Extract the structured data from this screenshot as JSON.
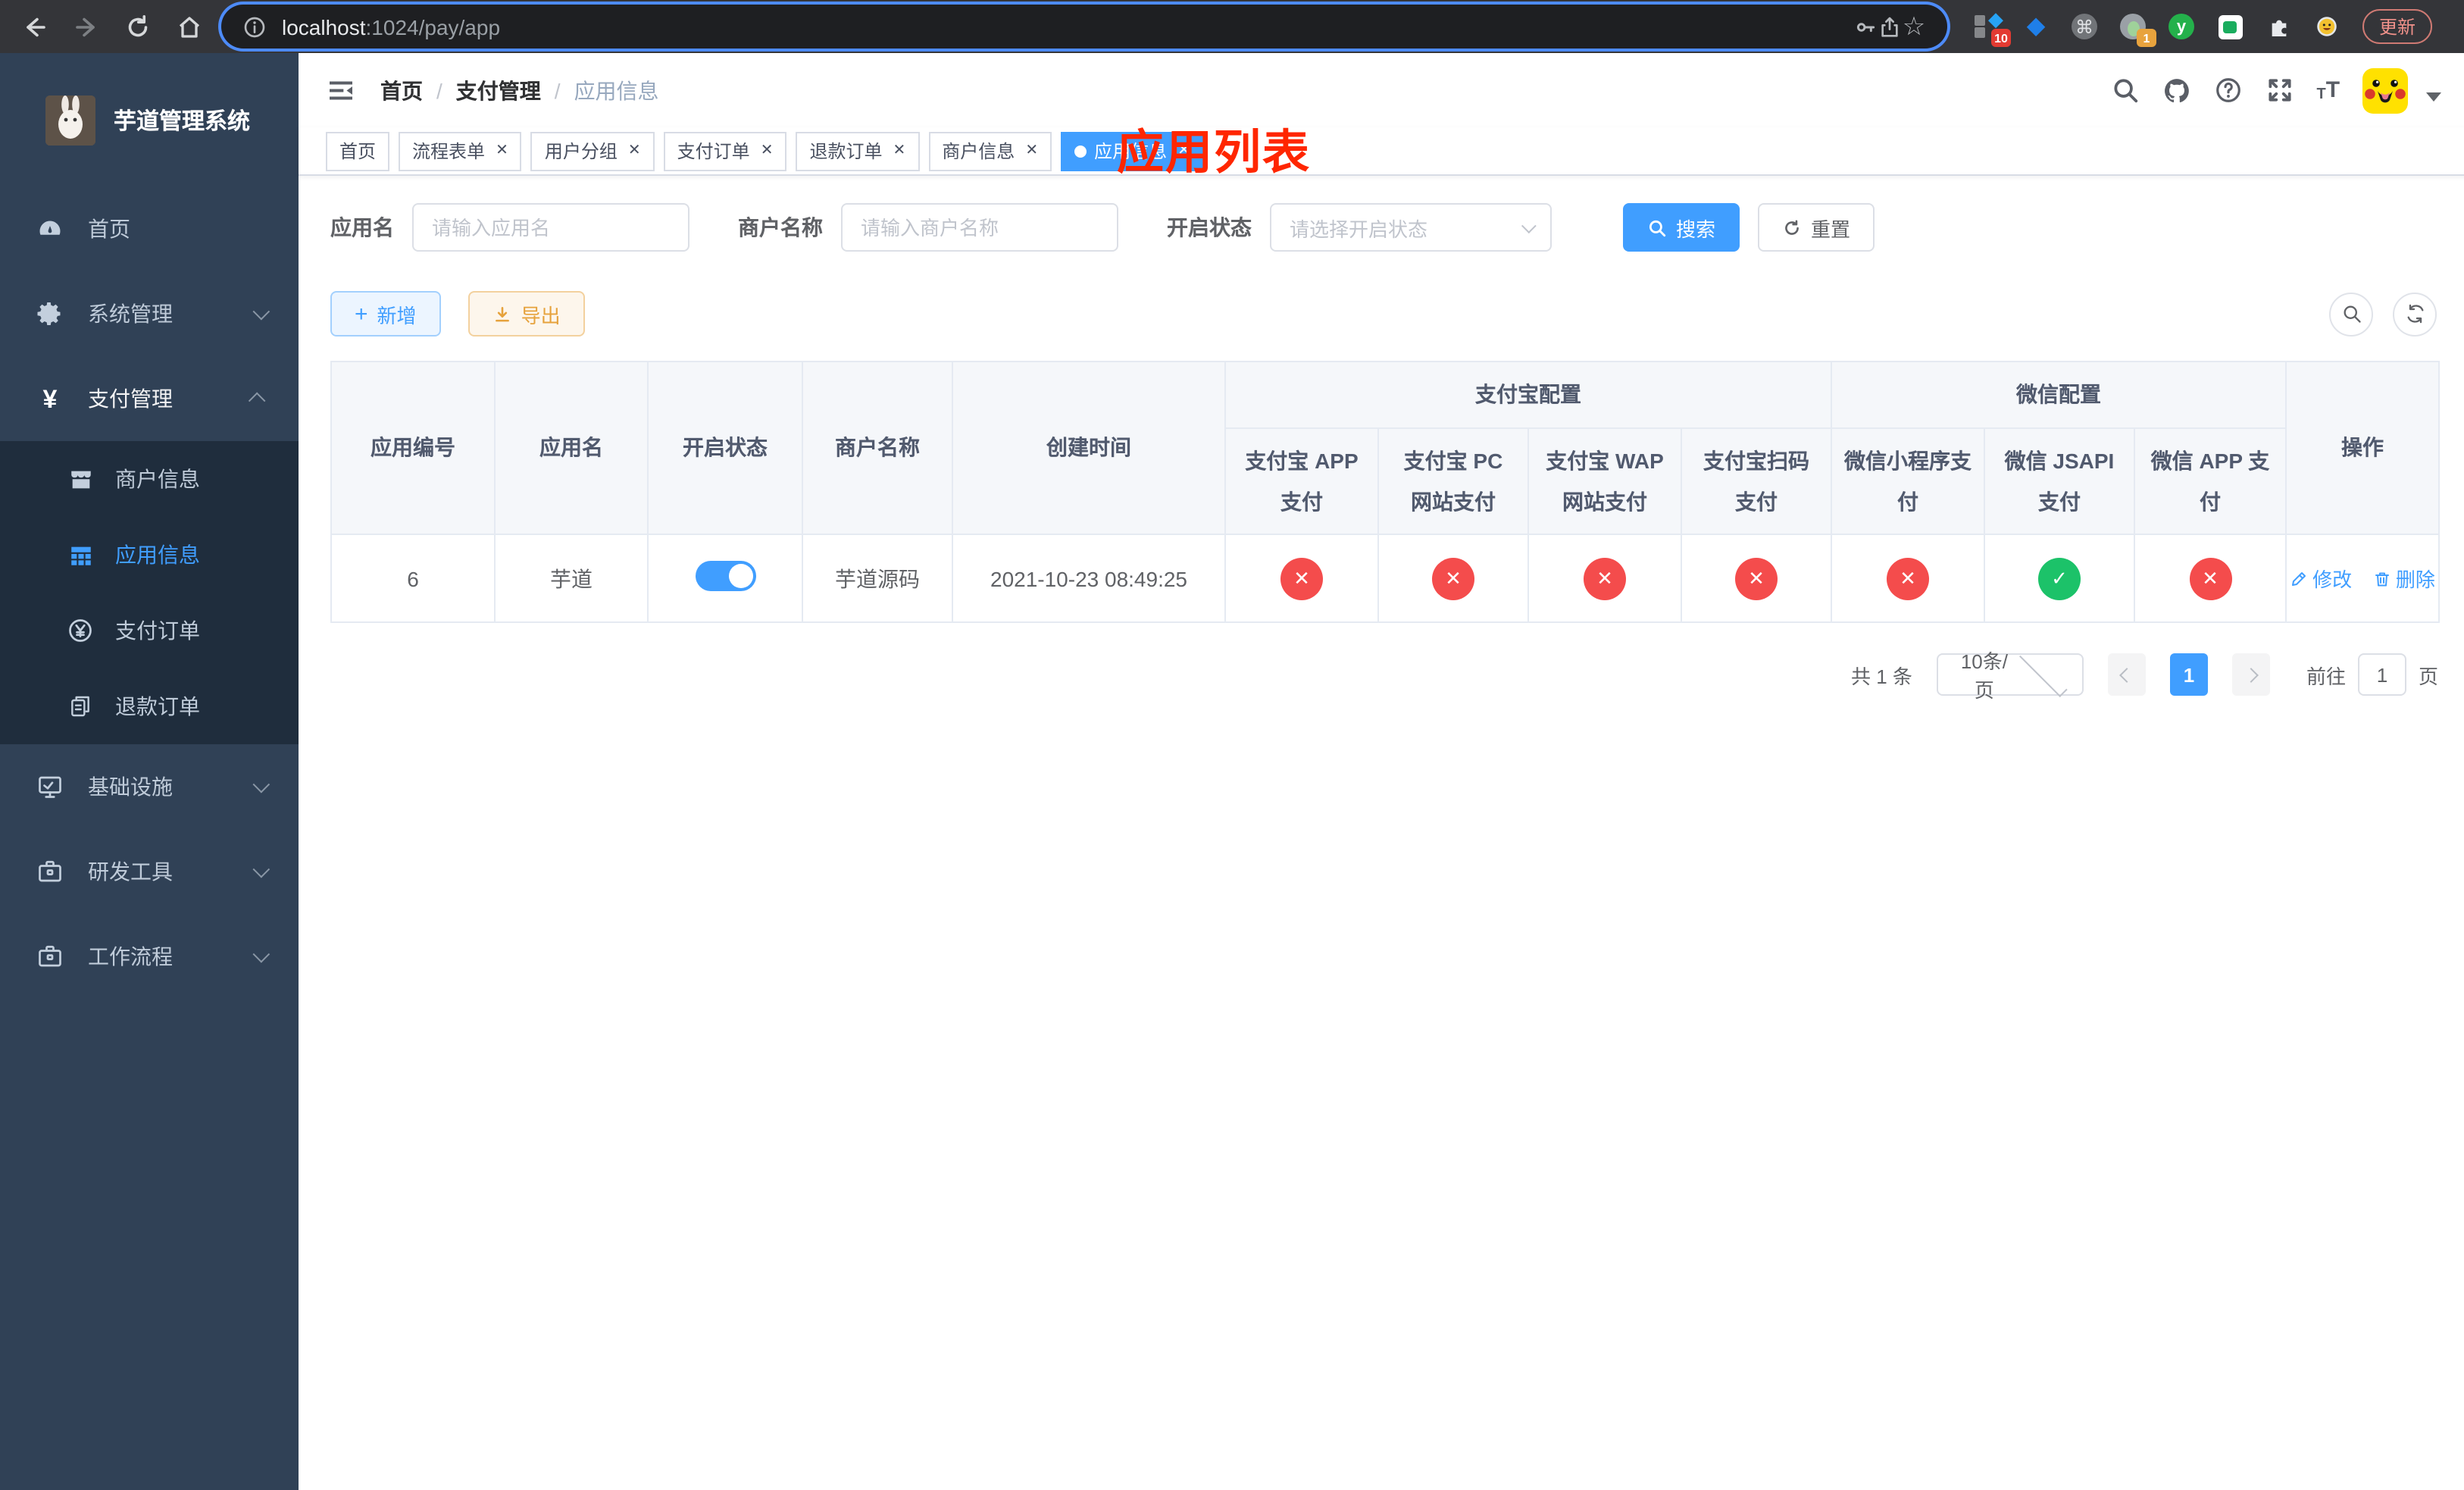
{
  "browser": {
    "url_host": "localhost",
    "url_rest": ":1024/pay/app",
    "update_label": "更新",
    "ext_badge_a": "10",
    "ext_badge_b": "1",
    "ext_y": "y"
  },
  "sidebar": {
    "title": "芋道管理系统",
    "items": [
      {
        "label": "首页"
      },
      {
        "label": "系统管理"
      },
      {
        "label": "支付管理"
      },
      {
        "label": "基础设施"
      },
      {
        "label": "研发工具"
      },
      {
        "label": "工作流程"
      }
    ],
    "submenu": [
      {
        "label": "商户信息"
      },
      {
        "label": "应用信息"
      },
      {
        "label": "支付订单"
      },
      {
        "label": "退款订单"
      }
    ]
  },
  "header": {
    "breadcrumb": [
      "首页",
      "支付管理",
      "应用信息"
    ],
    "overlay_title": "应用列表"
  },
  "tabs": [
    {
      "label": "首页"
    },
    {
      "label": "流程表单"
    },
    {
      "label": "用户分组"
    },
    {
      "label": "支付订单"
    },
    {
      "label": "退款订单"
    },
    {
      "label": "商户信息"
    },
    {
      "label": "应用信息"
    }
  ],
  "filters": {
    "name_label": "应用名",
    "name_placeholder": "请输入应用名",
    "merchant_label": "商户名称",
    "merchant_placeholder": "请输入商户名称",
    "status_label": "开启状态",
    "status_placeholder": "请选择开启状态",
    "search_label": "搜索",
    "reset_label": "重置"
  },
  "toolbar": {
    "add_label": "新增",
    "export_label": "导出"
  },
  "table": {
    "columns": [
      "应用编号",
      "应用名",
      "开启状态",
      "商户名称",
      "创建时间"
    ],
    "alipay_group": "支付宝配置",
    "wechat_group": "微信配置",
    "alipay_columns": [
      "支付宝 APP 支付",
      "支付宝 PC 网站支付",
      "支付宝 WAP 网站支付",
      "支付宝扫码支付"
    ],
    "wechat_columns": [
      "微信小程序支付",
      "微信 JSAPI 支付",
      "微信 APP 支付"
    ],
    "actions_label": "操作",
    "row": {
      "id": "6",
      "name": "芋道",
      "enabled": true,
      "merchant": "芋道源码",
      "created": "2021-10-23 08:49:25",
      "channels": [
        false,
        false,
        false,
        false,
        false,
        true,
        false
      ],
      "edit_label": "修改",
      "delete_label": "删除"
    }
  },
  "pagination": {
    "total_label": "共 1 条",
    "page_size_label": "10条/页",
    "current_page": "1",
    "goto_label": "前往",
    "goto_value": "1",
    "page_suffix_label": "页"
  }
}
